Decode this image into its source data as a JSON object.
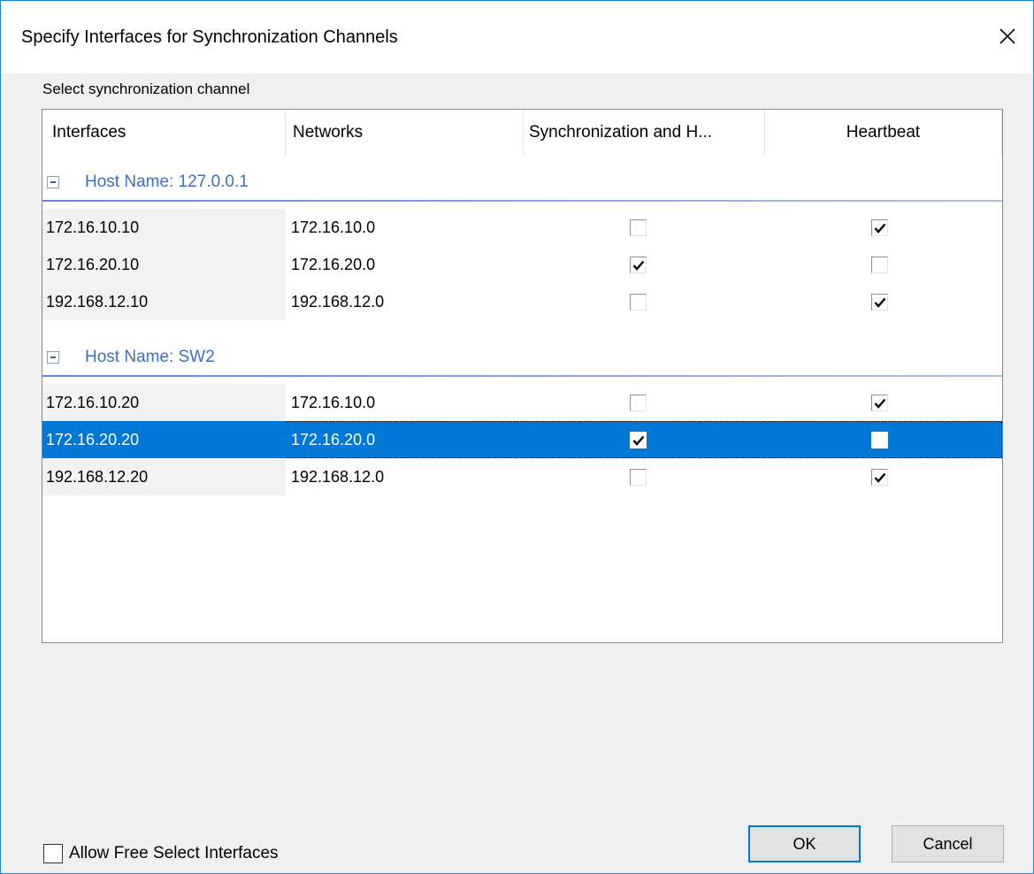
{
  "window": {
    "title": "Specify Interfaces for Synchronization Channels",
    "close_glyph": "✕"
  },
  "section_label": "Select synchronization channel",
  "table": {
    "columns": [
      "Interfaces",
      "Networks",
      "Synchronization and H...",
      "Heartbeat"
    ],
    "groups": [
      {
        "title": "Host Name: 127.0.0.1",
        "rows": [
          {
            "interface": "172.16.10.10",
            "network": "172.16.10.0",
            "sync": false,
            "heartbeat": true,
            "selected": false
          },
          {
            "interface": "172.16.20.10",
            "network": "172.16.20.0",
            "sync": true,
            "heartbeat": false,
            "selected": false
          },
          {
            "interface": "192.168.12.10",
            "network": "192.168.12.0",
            "sync": false,
            "heartbeat": true,
            "selected": false
          }
        ]
      },
      {
        "title": "Host Name: SW2",
        "rows": [
          {
            "interface": "172.16.10.20",
            "network": "172.16.10.0",
            "sync": false,
            "heartbeat": true,
            "selected": false
          },
          {
            "interface": "172.16.20.20",
            "network": "172.16.20.0",
            "sync": true,
            "heartbeat": false,
            "selected": true
          },
          {
            "interface": "192.168.12.20",
            "network": "192.168.12.0",
            "sync": false,
            "heartbeat": true,
            "selected": false
          }
        ]
      }
    ]
  },
  "footer": {
    "allow_free_select_label": "Allow Free Select Interfaces",
    "allow_free_select_checked": false,
    "ok_label": "OK",
    "cancel_label": "Cancel"
  },
  "colors": {
    "accent": "#0078d7",
    "group_title": "#3c6fc2"
  }
}
